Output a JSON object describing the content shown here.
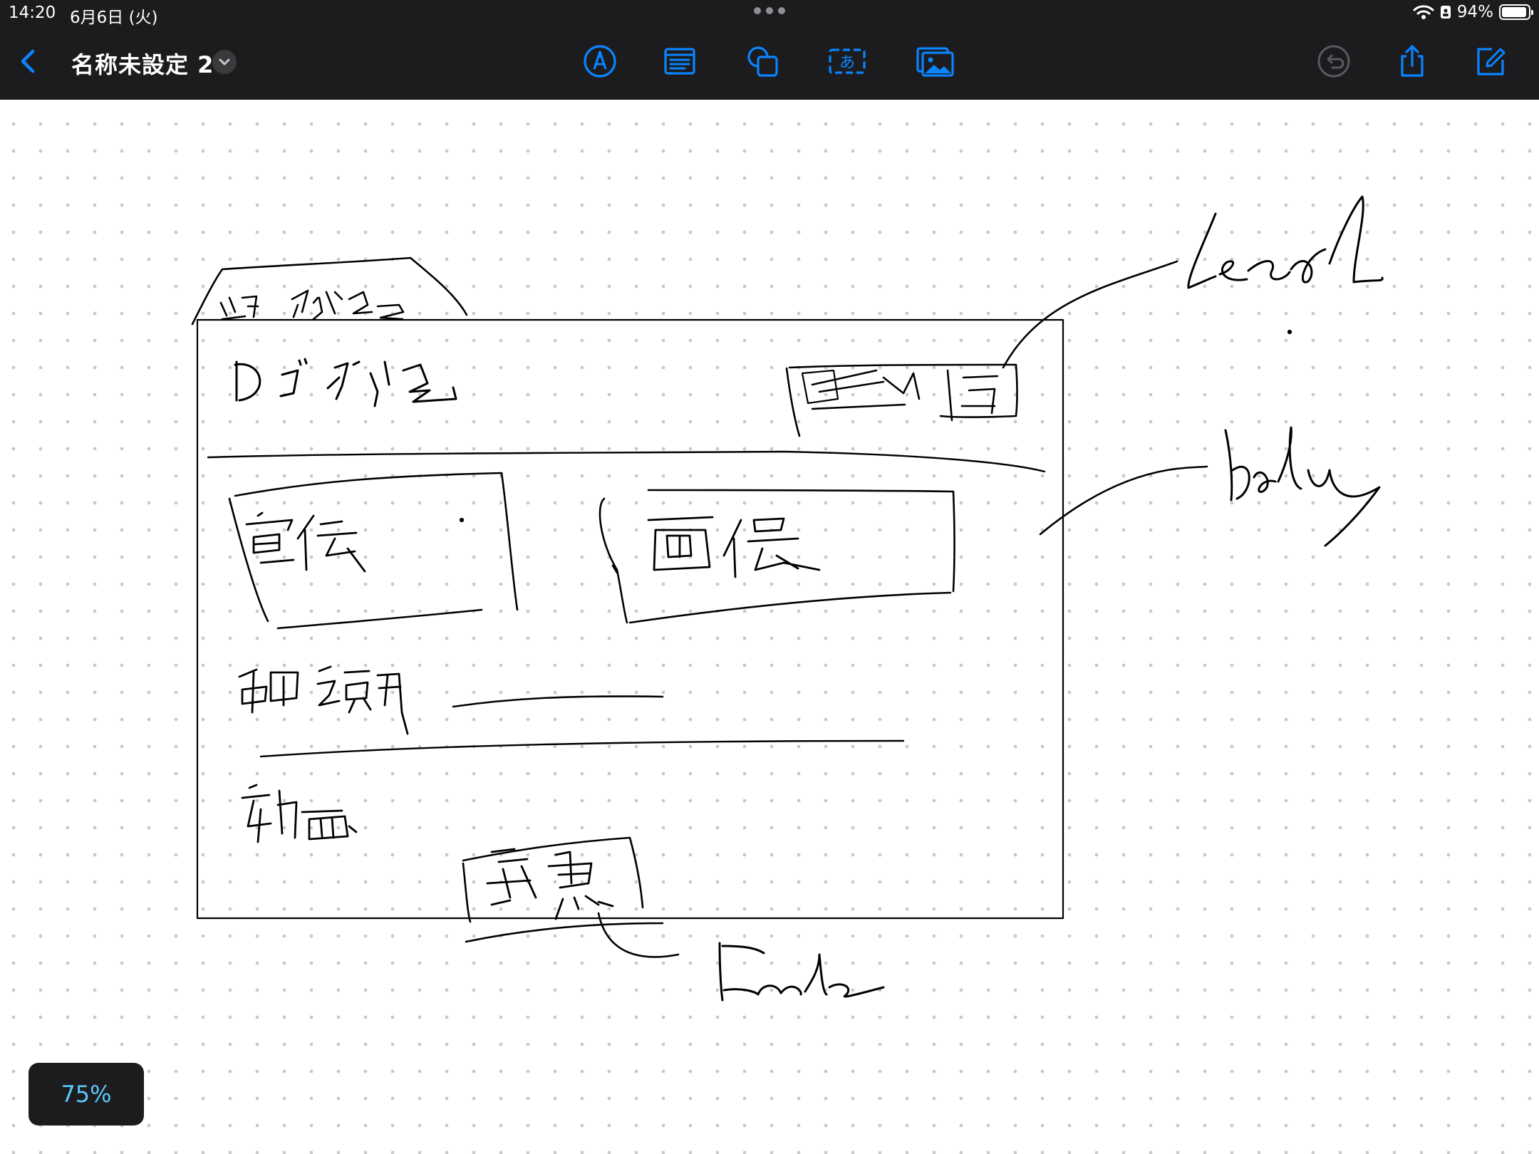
{
  "status_bar": {
    "time": "14:20",
    "date": "6月6日 (火)",
    "battery_percent": "94%",
    "battery_level": 0.94
  },
  "toolbar": {
    "document_title": "名称未設定 2",
    "accent_color": "#0a84ff",
    "icons": {
      "back": "chevron-left-icon",
      "title_menu": "chevron-down-icon",
      "pen": "pen-icon",
      "text": "text-icon",
      "shape": "shape-icon",
      "textbox": "textbox-icon",
      "media": "image-icon",
      "undo": "undo-icon",
      "share": "share-icon",
      "compose": "compose-icon"
    },
    "textbox_glyph": "あ"
  },
  "canvas": {
    "background": "dot-grid",
    "ink_color": "#000000"
  },
  "zoom": {
    "level": "75%"
  }
}
